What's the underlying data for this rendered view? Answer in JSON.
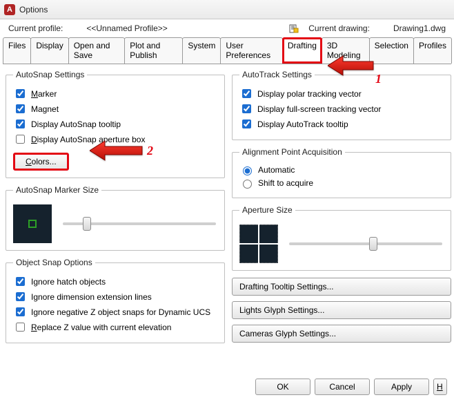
{
  "window": {
    "title": "Options"
  },
  "profile": {
    "label": "Current profile:",
    "value": "<<Unnamed Profile>>",
    "drawing_label": "Current drawing:",
    "drawing_value": "Drawing1.dwg"
  },
  "tabs": [
    "Files",
    "Display",
    "Open and Save",
    "Plot and Publish",
    "System",
    "User Preferences",
    "Drafting",
    "3D Modeling",
    "Selection",
    "Profiles"
  ],
  "left": {
    "autosnap": {
      "legend": "AutoSnap Settings",
      "marker": "arker",
      "marker_prefix": "M",
      "magnet": "Magnet",
      "tooltip": "Display AutoSnap tooltip",
      "aperture_prefix": "D",
      "aperture": "isplay AutoSnap aperture box",
      "colors_prefix": "C",
      "colors": "olors..."
    },
    "markersize": {
      "legend": "AutoSnap Marker Size"
    },
    "objsnap": {
      "legend": "Object Snap Options",
      "hatch": "Ignore hatch objects",
      "dim": "Ignore dimension extension lines",
      "negz": "Ignore negative Z object snaps for Dynamic UCS",
      "replacez_prefix": "R",
      "replacez": "eplace Z value with current elevation"
    }
  },
  "right": {
    "autotrack": {
      "legend": "AutoTrack Settings",
      "polar": "Display polar tracking vector",
      "fullscreen": "Display full-screen tracking vector",
      "tooltip": "Display AutoTrack tooltip"
    },
    "alignment": {
      "legend": "Alignment Point Acquisition",
      "auto": "Automatic",
      "shift": "Shift to acquire"
    },
    "aperture": {
      "legend": "Aperture Size"
    },
    "buttons": {
      "tooltip": "Drafting Tooltip Settings...",
      "lights": "Lights Glyph Settings...",
      "cameras": "Cameras Glyph Settings..."
    }
  },
  "footer": {
    "ok": "OK",
    "cancel": "Cancel",
    "apply": "Apply",
    "help_first": "H"
  },
  "annotations": {
    "n1": "1",
    "n2": "2"
  }
}
